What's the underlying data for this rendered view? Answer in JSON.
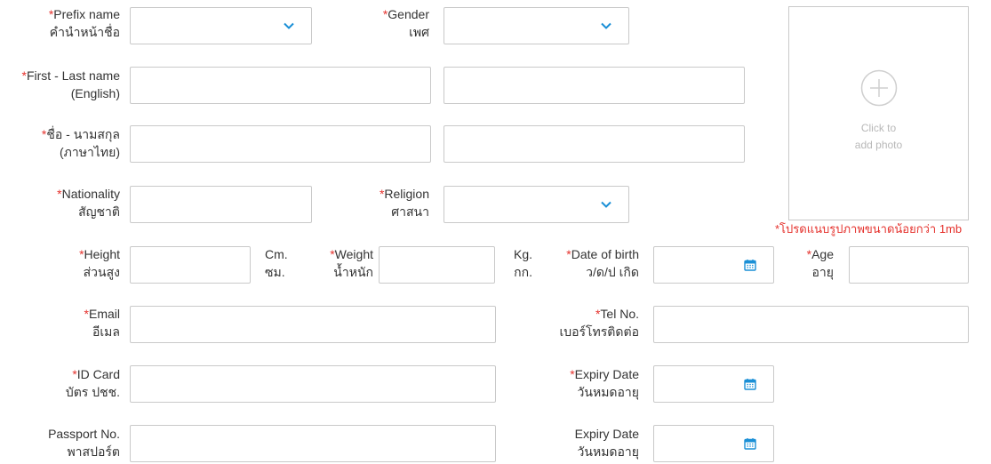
{
  "colors": {
    "required": "#e5322d",
    "accent": "#1a8fd6",
    "border": "#c9c9c9"
  },
  "required_mark": "*",
  "prefix": {
    "en": "Prefix name",
    "th": "คำนำหน้าชื่อ",
    "value": ""
  },
  "gender": {
    "en": "Gender",
    "th": "เพศ",
    "value": ""
  },
  "name_en": {
    "en": "First - Last name",
    "th": "(English)",
    "first": "",
    "last": ""
  },
  "name_th": {
    "en": "ชื่อ - นามสกุล",
    "th": "(ภาษาไทย)",
    "first": "",
    "last": ""
  },
  "nationality": {
    "en": "Nationality",
    "th": "สัญชาติ",
    "value": ""
  },
  "religion": {
    "en": "Religion",
    "th": "ศาสนา",
    "value": ""
  },
  "height": {
    "en": "Height",
    "th": "ส่วนสูง",
    "unit_en": "Cm.",
    "unit_th": "ซม.",
    "value": ""
  },
  "weight": {
    "en": "Weight",
    "th": "น้ำหนัก",
    "unit_en": "Kg.",
    "unit_th": "กก.",
    "value": ""
  },
  "dob": {
    "en": "Date of birth",
    "th": "ว/ด/ป เกิด",
    "value": "",
    "icon": "calendar-icon"
  },
  "age": {
    "en": "Age",
    "th": "อายุ",
    "value": ""
  },
  "email": {
    "en": "Email",
    "th": "อีเมล",
    "value": ""
  },
  "tel": {
    "en": "Tel No.",
    "th": "เบอร์โทรติดต่อ",
    "value": ""
  },
  "id_card": {
    "en": "ID Card",
    "th": "บัตร ปชช.",
    "value": ""
  },
  "id_expiry": {
    "en": "Expiry Date",
    "th": "วันหมดอายุ",
    "value": ""
  },
  "passport": {
    "en": "Passport No.",
    "th": "พาสปอร์ต",
    "value": ""
  },
  "passport_expiry": {
    "en": "Expiry Date",
    "th": "วันหมดอายุ",
    "value": ""
  },
  "photo": {
    "line1": "Click to",
    "line2": "add photo",
    "note": "*โปรดแนบรูปภาพขนาดน้อยกว่า 1mb",
    "icon": "plus-circle-icon"
  }
}
